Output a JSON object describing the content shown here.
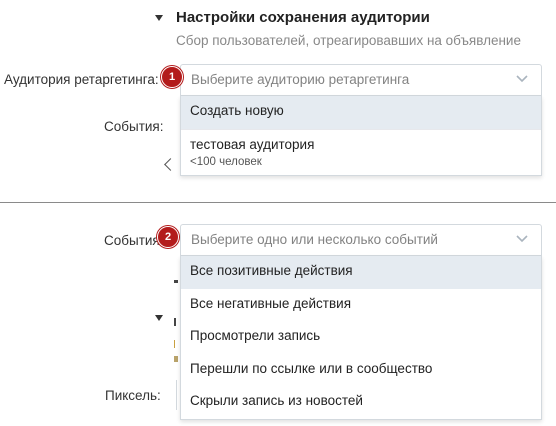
{
  "top": {
    "section_title": "Настройки сохранения аудитории",
    "section_subtitle": "Сбор пользователей, отреагировавших на объявление",
    "audience_label": "Аудитория ретаргетинга:",
    "audience_placeholder": "Выберите аудиторию ретаргетинга",
    "events_label": "События:",
    "badge": "1",
    "options": [
      {
        "label": "Создать новую"
      },
      {
        "label": "тестовая аудитория",
        "sub": "<100 человек"
      }
    ]
  },
  "bottom": {
    "events_label": "События:",
    "events_placeholder": "Выберите одно или несколько событий",
    "pixel_label": "Пиксель:",
    "badge": "2",
    "options": [
      {
        "label": "Все позитивные действия"
      },
      {
        "label": "Все негативные действия"
      },
      {
        "label": "Просмотрели запись"
      },
      {
        "label": "Перешли по ссылке или в сообщество"
      },
      {
        "label": "Скрыли запись из новостей"
      }
    ]
  },
  "colors": {
    "highlight": "#e5ebf1",
    "badge": "#b31b1b",
    "border": "#d3d9de"
  }
}
